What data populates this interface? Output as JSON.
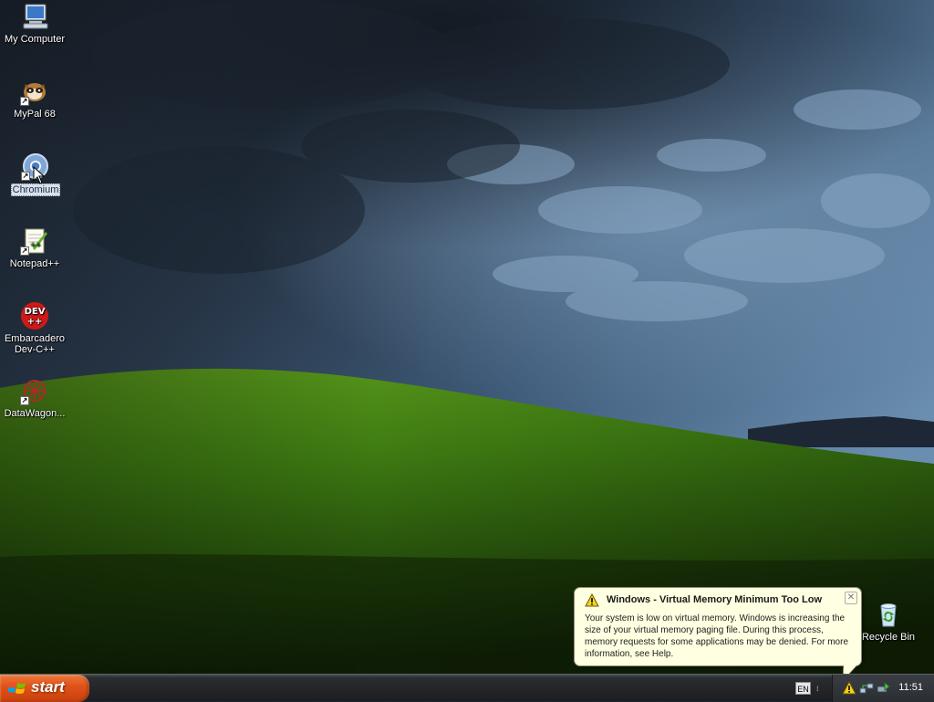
{
  "desktop": {
    "icons": [
      {
        "label": "My Computer",
        "icon": "computer-icon"
      },
      {
        "label": "MyPal 68",
        "icon": "mypal-browser-icon"
      },
      {
        "label": "Chromium",
        "icon": "chromium-icon",
        "selected": true
      },
      {
        "label": "Notepad++",
        "icon": "notepad-plus-plus-icon"
      },
      {
        "label": "Embarcadero",
        "label2": "Dev-C++",
        "icon": "devcpp-icon",
        "icon_text": "DEV",
        "icon_text2": "++"
      },
      {
        "label": "DataWagon...",
        "icon": "datawagon-icon"
      },
      {
        "label": "Recycle Bin",
        "icon": "recycle-bin-icon"
      }
    ]
  },
  "balloon": {
    "title": "Windows - Virtual Memory Minimum Too Low",
    "body": "Your system is low on virtual memory. Windows is increasing the size of your virtual memory paging file. During this process, memory requests for some applications may be denied. For more information, see Help.",
    "close_glyph": "✕",
    "icon": "warning-icon"
  },
  "taskbar": {
    "start_label": "start",
    "language": "EN",
    "language_arrow": "⁞",
    "clock": "11:51",
    "tray_icons": [
      "warning-icon",
      "network-icon",
      "safely-remove-hardware-icon"
    ]
  },
  "colors": {
    "start_button": "#e0541a",
    "balloon_background": "#ffffe1",
    "taskbar": "#242629",
    "hill_green": "#3d7a12",
    "sky": "#3a5878"
  }
}
